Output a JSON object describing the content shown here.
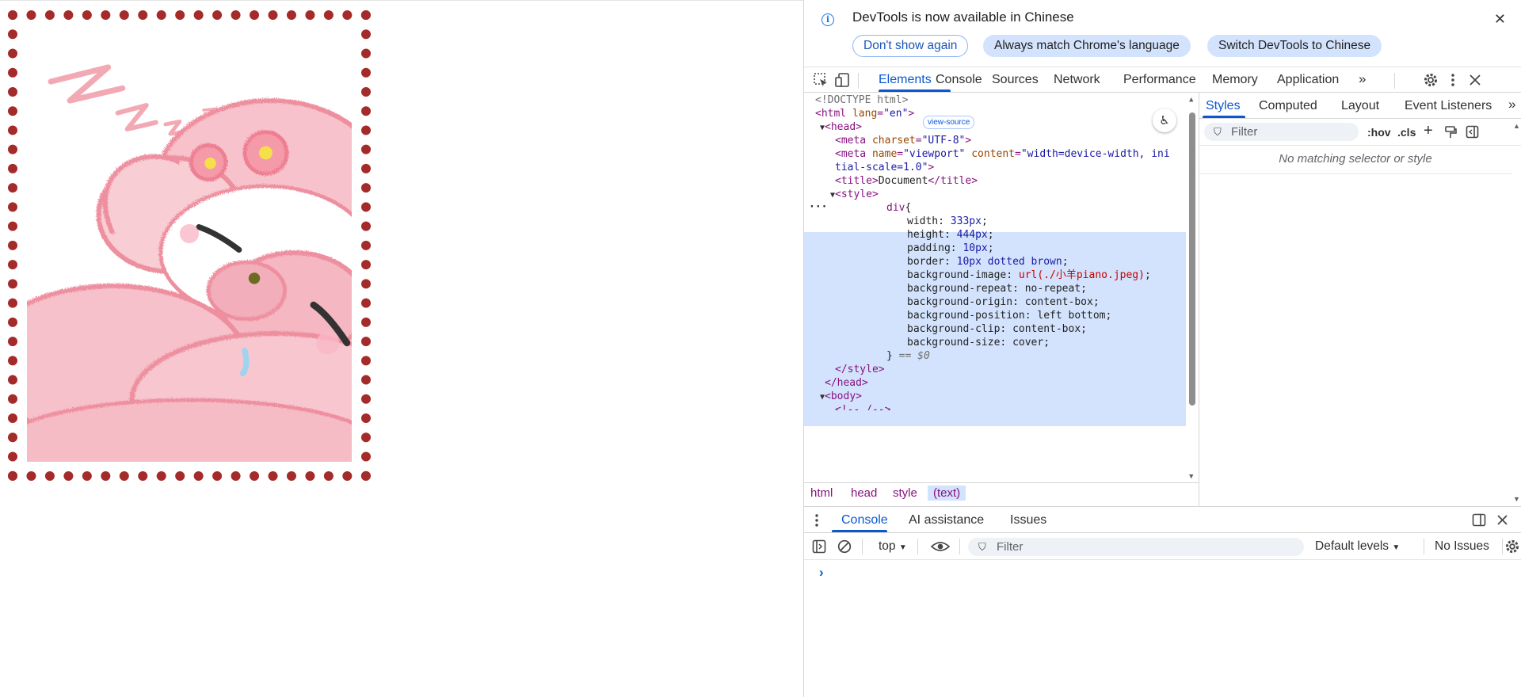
{
  "infobar": {
    "message": "DevTools is now available in Chinese",
    "dont_show": "Don't show again",
    "always_match": "Always match Chrome's language",
    "switch": "Switch DevTools to Chinese"
  },
  "main_tabs": [
    "Elements",
    "Console",
    "Sources",
    "Network",
    "Performance",
    "Memory",
    "Application"
  ],
  "elements_tree": {
    "doctype": "<!DOCTYPE html>",
    "html_open": "<html",
    "html_attr": "lang",
    "html_val": "\"en\"",
    "view_source": "view-source",
    "head_open": "<head>",
    "meta1": "<meta",
    "meta1_attr": "charset",
    "meta1_val": "\"UTF-8\"",
    "meta2": "<meta",
    "meta2_attr1": "name",
    "meta2_val1": "\"viewport\"",
    "meta2_attr2": "content",
    "meta2_val2a": "\"width=device-width, ini",
    "meta2_val2b": "tial-scale=1.0\"",
    "title_open": "<title>",
    "title_text": "Document",
    "title_close": "</title>",
    "style_open": "<style>",
    "selector": "div",
    "declarations": [
      {
        "prop": "width",
        "value": "333px"
      },
      {
        "prop": "height",
        "value": "444px"
      },
      {
        "prop": "padding",
        "value": "10px"
      },
      {
        "prop": "border",
        "value": "10px dotted brown"
      },
      {
        "prop": "background-image",
        "value": "url(./小羊piano.jpeg)"
      },
      {
        "prop": "background-repeat",
        "value": "no-repeat"
      },
      {
        "prop": "background-origin",
        "value": "content-box"
      },
      {
        "prop": "background-position",
        "value": "left bottom"
      },
      {
        "prop": "background-clip",
        "value": "content-box"
      },
      {
        "prop": "background-size",
        "value": "cover"
      }
    ],
    "close_brace": "}",
    "dollar0": "== $0",
    "style_close": "</style>",
    "head_close": "</head>",
    "body_open": "<body>",
    "partial": "<!-- /-->"
  },
  "breadcrumbs": [
    "html",
    "head",
    "style",
    "(text)"
  ],
  "styles": {
    "tabs": [
      "Styles",
      "Computed",
      "Layout",
      "Event Listeners"
    ],
    "filter_placeholder": "Filter",
    "hov": ":hov",
    "cls": ".cls",
    "no_match": "No matching selector or style"
  },
  "drawer": {
    "tabs": [
      "Console",
      "AI assistance",
      "Issues"
    ],
    "context": "top",
    "filter_placeholder": "Filter",
    "levels": "Default levels",
    "issues": "No Issues"
  }
}
